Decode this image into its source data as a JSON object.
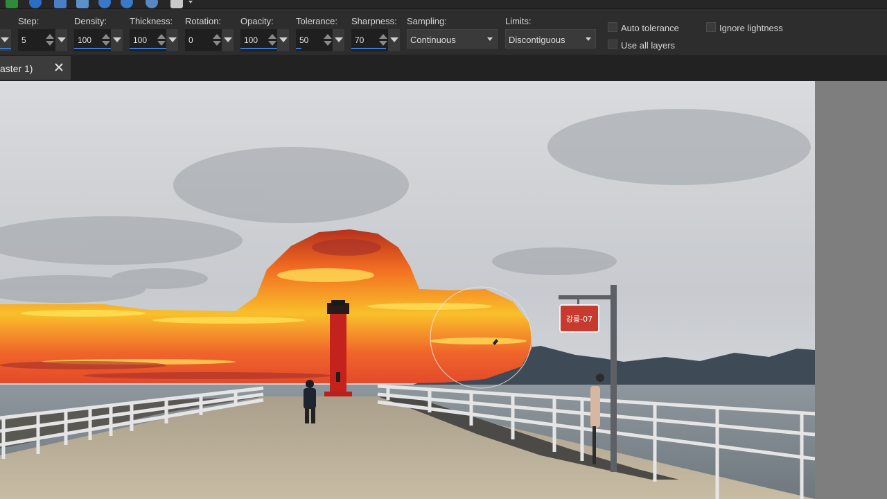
{
  "toolbar_icons": [
    "brush-icon",
    "info-icon",
    "calculator-icon",
    "dice-icon",
    "zoom-out-icon",
    "zoom-in-icon",
    "zoom-fit-icon",
    "clipboard-icon"
  ],
  "options": {
    "step": {
      "label": "Step:",
      "value": "5"
    },
    "density": {
      "label": "Density:",
      "value": "100"
    },
    "thickness": {
      "label": "Thickness:",
      "value": "100"
    },
    "rotation": {
      "label": "Rotation:",
      "value": "0"
    },
    "opacity": {
      "label": "Opacity:",
      "value": "100"
    },
    "tolerance": {
      "label": "Tolerance:",
      "value": "50"
    },
    "sharpness": {
      "label": "Sharpness:",
      "value": "70"
    },
    "sampling": {
      "label": "Sampling:",
      "value": "Continuous"
    },
    "limits": {
      "label": "Limits:",
      "value": "Discontiguous"
    },
    "auto_tolerance": {
      "label": "Auto tolerance",
      "checked": false
    },
    "ignore_lightness": {
      "label": "Ignore lightness",
      "checked": false
    },
    "use_all_layers": {
      "label": "Use all layers",
      "checked": false
    }
  },
  "document_tab": {
    "title": "aster 1)",
    "close_icon": "close-icon"
  },
  "canvas": {
    "sign_text": "강릉-07",
    "colors": {
      "sky": "#c9ccd1",
      "sunset_orange": "#f0652a",
      "sunset_yellow": "#f7d22a",
      "lighthouse": "#c8231f",
      "sea": "#8e979c",
      "pier": "#b9ad96"
    }
  },
  "colors": {
    "accent": "#3d7bd0",
    "toolbar_bg": "#2d2d2d",
    "panel_bg": "#7e7e7e"
  }
}
